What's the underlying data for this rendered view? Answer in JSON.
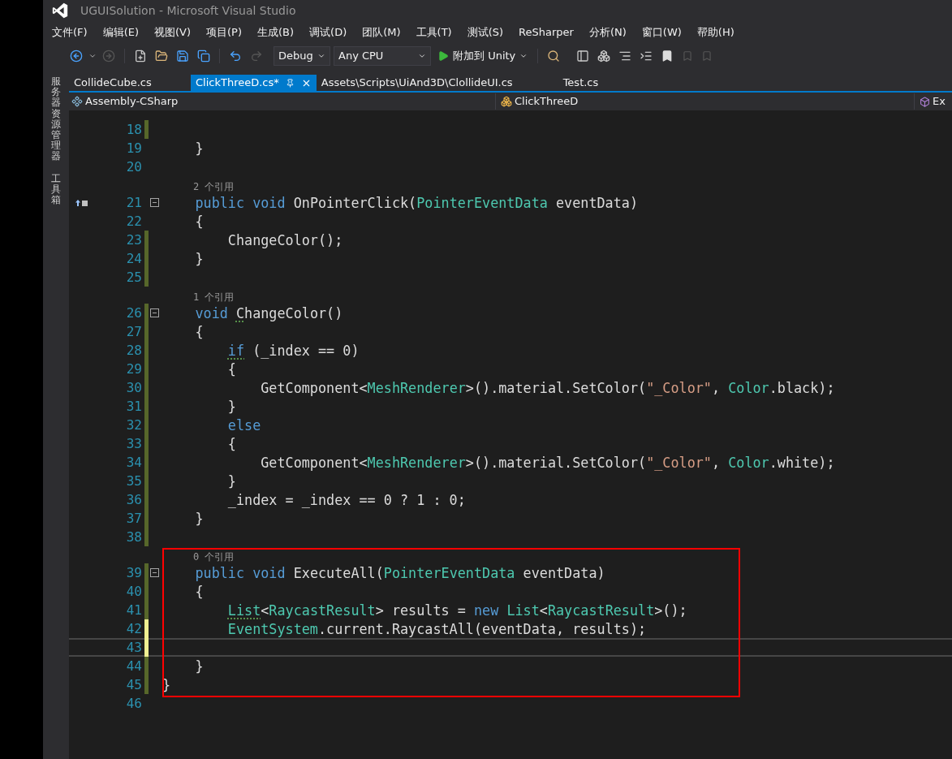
{
  "window": {
    "title": "UGUISolution - Microsoft Visual Studio"
  },
  "menu": [
    "文件(F)",
    "编辑(E)",
    "视图(V)",
    "项目(P)",
    "生成(B)",
    "调试(D)",
    "团队(M)",
    "工具(T)",
    "测试(S)",
    "ReSharper",
    "分析(N)",
    "窗口(W)",
    "帮助(H)"
  ],
  "toolbar": {
    "configuration": "Debug",
    "platform": "Any CPU",
    "run_label": "附加到 Unity"
  },
  "side_panels": [
    "服务器资源管理器",
    "工具箱"
  ],
  "tabs": [
    {
      "label": "CollideCube.cs",
      "selected": false,
      "pinned": false
    },
    {
      "label": "ClickThreeD.cs*",
      "selected": true,
      "pinned": true
    },
    {
      "label": "Assets\\Scripts\\UiAnd3D\\ClollideUI.cs",
      "selected": false,
      "pinned": false
    },
    {
      "label": "Test.cs",
      "selected": false,
      "pinned": false
    }
  ],
  "navigation": {
    "project": "Assembly-CSharp",
    "type": "ClickThreeD",
    "member": "Ex"
  },
  "editor": {
    "lines": [
      {
        "kind": "code",
        "number": "18",
        "color": "#57672a",
        "fold": false,
        "glyph": false,
        "current": false,
        "boxed": false
      },
      {
        "kind": "code",
        "number": "19",
        "fold": false,
        "glyph": false,
        "current": false,
        "boxed": false,
        "tokens": [
          {
            "text": "    }",
            "kind": "text"
          }
        ]
      },
      {
        "kind": "code",
        "number": "20",
        "fold": false,
        "glyph": false,
        "current": false,
        "boxed": false
      },
      {
        "kind": "codelens",
        "text": "2 个引用",
        "boxed": false
      },
      {
        "kind": "code",
        "number": "21",
        "fold": true,
        "glyph": true,
        "current": false,
        "boxed": false,
        "tokens": [
          {
            "text": "    public void",
            "kind": "kw"
          },
          {
            "text": " OnPointerClick(",
            "kind": "text"
          },
          {
            "text": "PointerEventData",
            "kind": "type"
          },
          {
            "text": " eventData)",
            "kind": "text"
          }
        ]
      },
      {
        "kind": "code",
        "number": "22",
        "fold": false,
        "glyph": false,
        "current": false,
        "boxed": false,
        "tokens": [
          {
            "text": "    {",
            "kind": "text"
          }
        ]
      },
      {
        "kind": "code",
        "number": "23",
        "color": "#57672a",
        "fold": false,
        "glyph": false,
        "current": false,
        "boxed": false,
        "tokens": [
          {
            "text": "        ChangeColor();",
            "kind": "text"
          }
        ]
      },
      {
        "kind": "code",
        "number": "24",
        "color": "#57672a",
        "fold": false,
        "glyph": false,
        "current": false,
        "boxed": false,
        "tokens": [
          {
            "text": "    }",
            "kind": "text"
          }
        ]
      },
      {
        "kind": "code",
        "number": "25",
        "color": "#57672a",
        "fold": false,
        "glyph": false,
        "current": false,
        "boxed": false
      },
      {
        "kind": "codelens",
        "text": "1 个引用",
        "boxed": false
      },
      {
        "kind": "code",
        "number": "26",
        "color": "#57672a",
        "fold": true,
        "glyph": false,
        "current": false,
        "boxed": false,
        "tokens": [
          {
            "text": "    void ",
            "kind": "kw"
          },
          {
            "text": "C",
            "kind": "text",
            "squiggle": true
          },
          {
            "text": "hangeColor()",
            "kind": "text"
          }
        ]
      },
      {
        "kind": "code",
        "number": "27",
        "color": "#57672a",
        "fold": false,
        "glyph": false,
        "current": false,
        "boxed": false,
        "tokens": [
          {
            "text": "    {",
            "kind": "text"
          }
        ]
      },
      {
        "kind": "code",
        "number": "28",
        "color": "#57672a",
        "fold": false,
        "glyph": false,
        "current": false,
        "boxed": false,
        "tokens": [
          {
            "text": "        if",
            "kind": "kw",
            "squiggle": true
          },
          {
            "text": " (_index == 0)",
            "kind": "text"
          }
        ]
      },
      {
        "kind": "code",
        "number": "29",
        "color": "#57672a",
        "fold": false,
        "glyph": false,
        "current": false,
        "boxed": false,
        "tokens": [
          {
            "text": "        {",
            "kind": "text"
          }
        ]
      },
      {
        "kind": "code",
        "number": "30",
        "color": "#57672a",
        "fold": false,
        "glyph": false,
        "current": false,
        "boxed": false,
        "tokens": [
          {
            "text": "            GetComponent<",
            "kind": "text"
          },
          {
            "text": "MeshRenderer",
            "kind": "type"
          },
          {
            "text": ">().material.SetColor(",
            "kind": "text"
          },
          {
            "text": "\"_Color\"",
            "kind": "str"
          },
          {
            "text": ", ",
            "kind": "text"
          },
          {
            "text": "Color",
            "kind": "type"
          },
          {
            "text": ".black);",
            "kind": "text"
          }
        ]
      },
      {
        "kind": "code",
        "number": "31",
        "color": "#57672a",
        "fold": false,
        "glyph": false,
        "current": false,
        "boxed": false,
        "tokens": [
          {
            "text": "        }",
            "kind": "text"
          }
        ]
      },
      {
        "kind": "code",
        "number": "32",
        "color": "#57672a",
        "fold": false,
        "glyph": false,
        "current": false,
        "boxed": false,
        "tokens": [
          {
            "text": "        else",
            "kind": "kw"
          }
        ]
      },
      {
        "kind": "code",
        "number": "33",
        "color": "#57672a",
        "fold": false,
        "glyph": false,
        "current": false,
        "boxed": false,
        "tokens": [
          {
            "text": "        {",
            "kind": "text"
          }
        ]
      },
      {
        "kind": "code",
        "number": "34",
        "color": "#57672a",
        "fold": false,
        "glyph": false,
        "current": false,
        "boxed": false,
        "tokens": [
          {
            "text": "            GetComponent<",
            "kind": "text"
          },
          {
            "text": "MeshRenderer",
            "kind": "type"
          },
          {
            "text": ">().material.SetColor(",
            "kind": "text"
          },
          {
            "text": "\"_Color\"",
            "kind": "str"
          },
          {
            "text": ", ",
            "kind": "text"
          },
          {
            "text": "Color",
            "kind": "type"
          },
          {
            "text": ".white);",
            "kind": "text"
          }
        ]
      },
      {
        "kind": "code",
        "number": "35",
        "color": "#57672a",
        "fold": false,
        "glyph": false,
        "current": false,
        "boxed": false,
        "tokens": [
          {
            "text": "        }",
            "kind": "text"
          }
        ]
      },
      {
        "kind": "code",
        "number": "36",
        "color": "#57672a",
        "fold": false,
        "glyph": false,
        "current": false,
        "boxed": false,
        "tokens": [
          {
            "text": "        _index = _index == 0 ? 1 : 0;",
            "kind": "text"
          }
        ]
      },
      {
        "kind": "code",
        "number": "37",
        "color": "#57672a",
        "fold": false,
        "glyph": false,
        "current": false,
        "boxed": false,
        "tokens": [
          {
            "text": "    }",
            "kind": "text"
          }
        ]
      },
      {
        "kind": "code",
        "number": "38",
        "color": "#57672a",
        "fold": false,
        "glyph": false,
        "current": false,
        "boxed": false
      },
      {
        "kind": "codelens",
        "text": "0 个引用",
        "boxed": true
      },
      {
        "kind": "code",
        "number": "39",
        "color": "#57672a",
        "fold": true,
        "glyph": false,
        "current": false,
        "boxed": true,
        "tokens": [
          {
            "text": "    public void",
            "kind": "kw"
          },
          {
            "text": " ExecuteAll(",
            "kind": "text"
          },
          {
            "text": "PointerEventData",
            "kind": "type"
          },
          {
            "text": " eventData)",
            "kind": "text"
          }
        ]
      },
      {
        "kind": "code",
        "number": "40",
        "color": "#57672a",
        "fold": false,
        "glyph": false,
        "current": false,
        "boxed": true,
        "tokens": [
          {
            "text": "    {",
            "kind": "text"
          }
        ]
      },
      {
        "kind": "code",
        "number": "41",
        "color": "#57672a",
        "fold": false,
        "glyph": false,
        "current": false,
        "boxed": true,
        "tokens": [
          {
            "text": "        List",
            "kind": "type",
            "squiggle": true
          },
          {
            "text": "<",
            "kind": "text"
          },
          {
            "text": "RaycastResult",
            "kind": "type"
          },
          {
            "text": "> results = ",
            "kind": "text"
          },
          {
            "text": "new",
            "kind": "kw"
          },
          {
            "text": " List",
            "kind": "type"
          },
          {
            "text": "<",
            "kind": "text"
          },
          {
            "text": "RaycastResult",
            "kind": "type"
          },
          {
            "text": ">();",
            "kind": "text"
          }
        ]
      },
      {
        "kind": "code",
        "number": "42",
        "color": "#efef91",
        "fold": false,
        "glyph": false,
        "current": false,
        "boxed": true,
        "tokens": [
          {
            "text": "        EventSystem",
            "kind": "type"
          },
          {
            "text": ".current.RaycastAll(eventData, results);",
            "kind": "text"
          }
        ]
      },
      {
        "kind": "code",
        "number": "43",
        "color": "#efef91",
        "fold": false,
        "glyph": false,
        "current": true,
        "boxed": true
      },
      {
        "kind": "code",
        "number": "44",
        "color": "#57672a",
        "fold": false,
        "glyph": false,
        "current": false,
        "boxed": true,
        "tokens": [
          {
            "text": "    }",
            "kind": "text"
          }
        ]
      },
      {
        "kind": "code",
        "number": "45",
        "color": "#57672a",
        "fold": false,
        "glyph": false,
        "current": false,
        "boxed": true,
        "tokens": [
          {
            "text": "}",
            "kind": "text"
          }
        ]
      },
      {
        "kind": "code",
        "number": "46",
        "fold": false,
        "glyph": false,
        "current": false,
        "boxed": false
      }
    ],
    "highlight": {
      "color": "#ff0000"
    }
  }
}
